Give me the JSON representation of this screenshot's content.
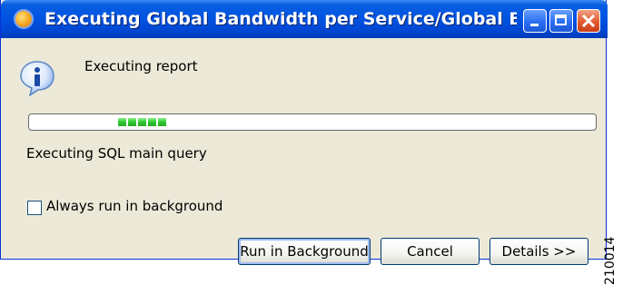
{
  "window": {
    "title": "Executing Global Bandwidth per Service/Global Band..."
  },
  "message": {
    "heading": "Executing report",
    "status": "Executing SQL main query"
  },
  "progress": {
    "blocks": 5
  },
  "options": {
    "always_background_label": "Always run in background",
    "always_background_checked": false
  },
  "buttons": {
    "run_background": "Run in Background",
    "cancel": "Cancel",
    "details": "Details >>"
  },
  "figure_id": "210014",
  "icons": {
    "app": "app-logo-icon",
    "info": "info-icon",
    "minimize": "minimize-icon",
    "maximize": "maximize-icon",
    "close": "close-icon"
  },
  "colors": {
    "titlebar": "#0054e3",
    "dialog_bg": "#ece9d8",
    "progress_fill": "#2fc92f",
    "close_button": "#e35a2f"
  }
}
